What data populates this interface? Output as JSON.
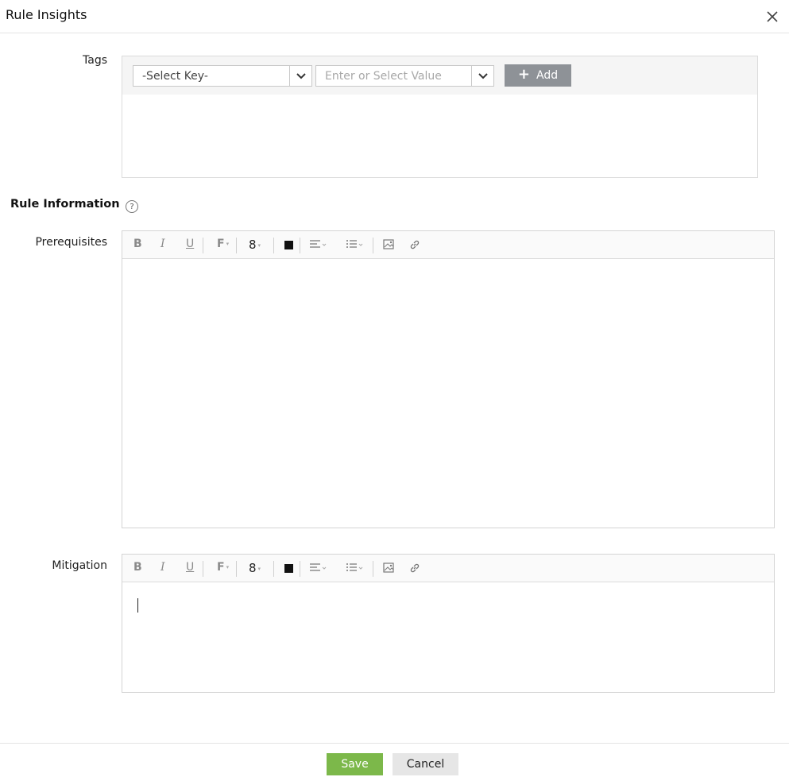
{
  "header": {
    "title": "Rule Insights",
    "close_icon": "close-icon"
  },
  "tags": {
    "label": "Tags",
    "key_select": {
      "value": "-Select Key-"
    },
    "value_select": {
      "placeholder": "Enter or Select Value"
    },
    "add_label": "Add"
  },
  "rule_info": {
    "title": "Rule Information",
    "help_glyph": "?"
  },
  "prerequisites": {
    "label": "Prerequisites"
  },
  "mitigation": {
    "label": "Mitigation"
  },
  "toolbar": {
    "bold": "B",
    "italic": "I",
    "underline": "U",
    "font": "F",
    "font_size": "8"
  },
  "footer": {
    "save_label": "Save",
    "cancel_label": "Cancel"
  },
  "colors": {
    "save": "#7cb84a",
    "add": "#8e9297",
    "cancel": "#e6e6e6",
    "text_color_swatch": "#111111"
  }
}
